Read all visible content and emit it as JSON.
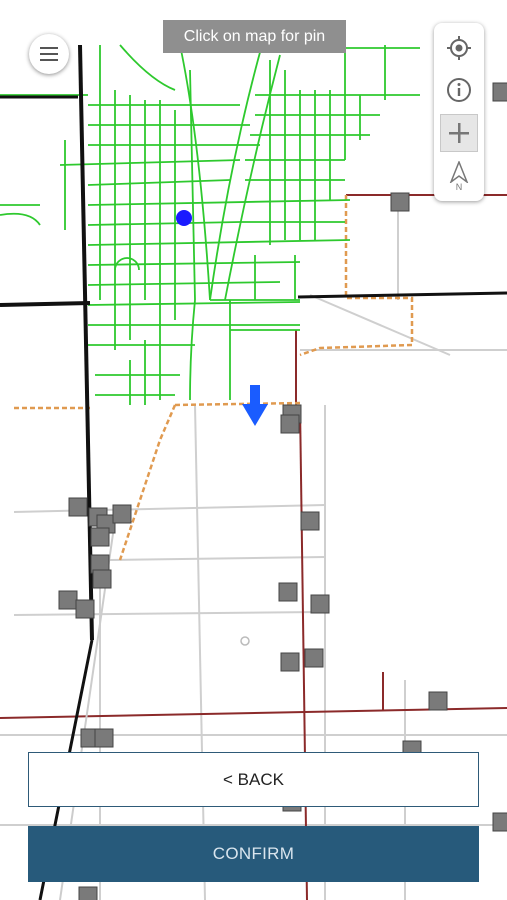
{
  "map": {
    "hint_text": "Click on map for pin",
    "north_label": "N",
    "colors": {
      "road_network": "#33cc33",
      "major_road": "#111111",
      "minor_road": "#c8c8c8",
      "boundary_red": "#8b1a1a",
      "boundary_orange": "#e0a050",
      "marker_fill": "#7a7a7a",
      "pin_dot": "#1a1aff",
      "arrow": "#1a5cff"
    }
  },
  "controls": {
    "locate_icon": "crosshair-target-icon",
    "info_icon": "info-circle-icon",
    "zoom_icon": "plus-icon",
    "north_icon": "north-arrow-icon",
    "menu_icon": "hamburger-menu-icon"
  },
  "actions": {
    "back_label": "< BACK",
    "confirm_label": "CONFIRM"
  }
}
